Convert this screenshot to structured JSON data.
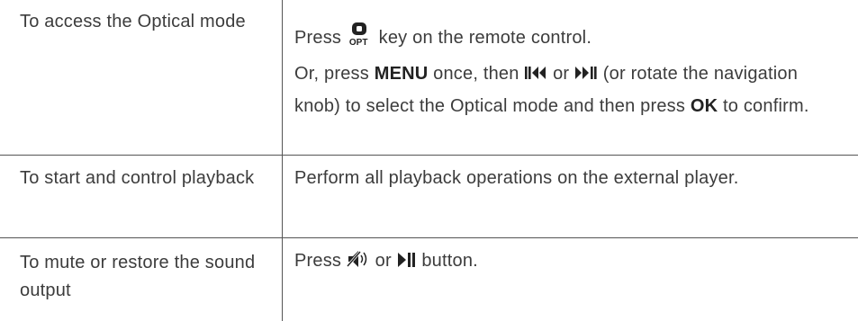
{
  "rows": [
    {
      "action": "To access the Optical mode",
      "line1": {
        "pre": "Press ",
        "icon_label": "OPT",
        "post": " key on the remote control."
      },
      "line2": {
        "a": "Or, press ",
        "menu": "MENU",
        "b": " once, then ",
        "c": " or ",
        "d": " (or rotate the navigation knob) to select the Optical mode and then press ",
        "ok": "OK",
        "e": " to confirm."
      }
    },
    {
      "action": "To start and control playback",
      "text": "Perform all playback operations on the external player."
    },
    {
      "action": "To mute or restore the sound output",
      "line": {
        "pre": "Press ",
        "mid": " or ",
        "post": " button."
      }
    }
  ],
  "icons": {
    "optical_key": "optical-key-icon",
    "prev_skip": "skip-previous-icon",
    "next_skip": "skip-next-icon",
    "mute": "mute-icon",
    "play_pause": "play-pause-icon"
  },
  "colors": {
    "text": "#3c3c3c",
    "keyword": "#222222",
    "rule": "#555555"
  }
}
